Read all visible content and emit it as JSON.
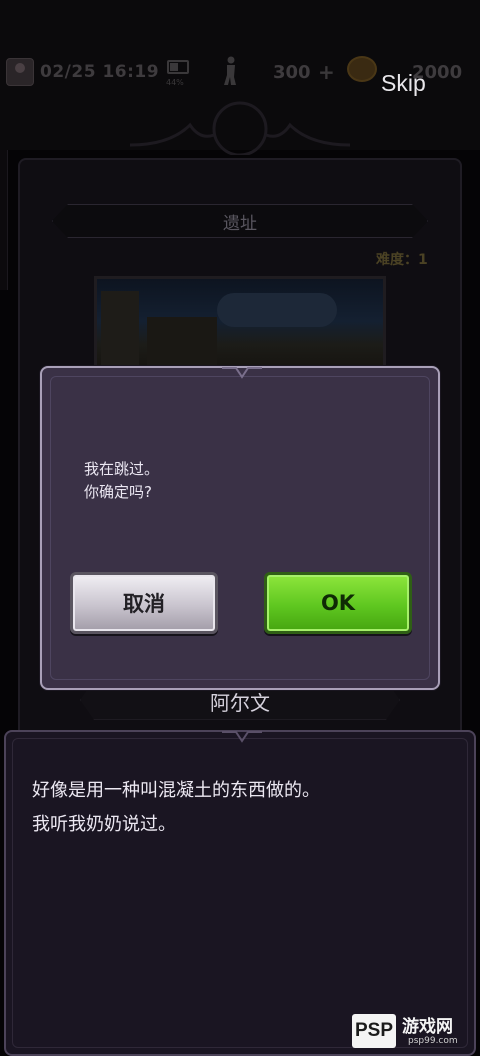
{
  "status_bar": {
    "datetime": "02/25 16:19",
    "battery_percent": "44%",
    "currency_1": "300",
    "currency_2": "2000",
    "skip_label": "Skip"
  },
  "location_panel": {
    "title": "遗址",
    "difficulty": "难度：1",
    "character_name": "阿尔文"
  },
  "confirm_dialog": {
    "message_line1": "我在跳过。",
    "message_line2": "你确定吗?",
    "cancel_label": "取消",
    "ok_label": "OK"
  },
  "story_box": {
    "line1": "好像是用一种叫混凝土的东西做的。",
    "line2": "我听我奶奶说过。"
  },
  "watermark": {
    "logo": "PSP",
    "name": "游戏网",
    "url": "psp99.com"
  },
  "colors": {
    "dialog_bg": "#3a3146",
    "ok_green": "#5fc720",
    "cancel_grey": "#c9c4ce",
    "panel_bg": "#1a1522"
  }
}
